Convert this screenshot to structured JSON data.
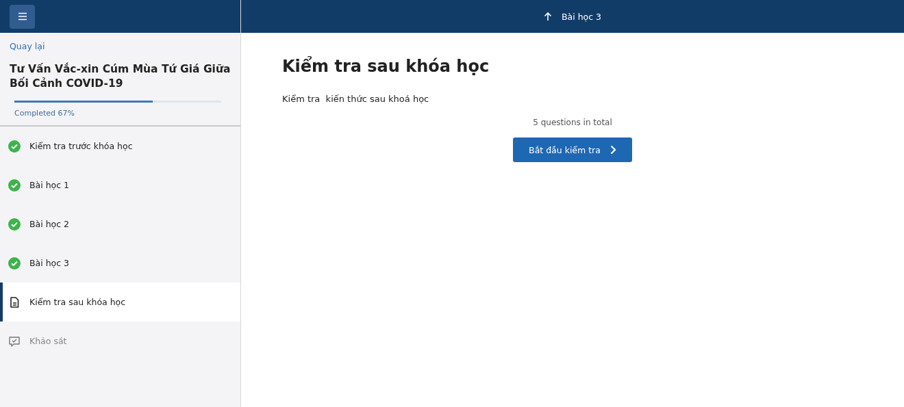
{
  "sidebar": {
    "back_link": "Quay lại",
    "course_title": "Tư Vấn Vắc-xin Cúm Mùa Tứ Giá Giữa Bối Cảnh COVID-19",
    "progress": {
      "level": 0.67,
      "label": "Completed 67%"
    },
    "items": [
      {
        "kind": "done",
        "label": "Kiểm tra trước khóa học",
        "selected": false
      },
      {
        "kind": "done",
        "label": "Bài học 1",
        "selected": false
      },
      {
        "kind": "done",
        "label": "Bài học 2",
        "selected": false
      },
      {
        "kind": "done",
        "label": "Bài học 3",
        "selected": false
      },
      {
        "kind": "quiz",
        "label": "Kiểm tra sau khóa học",
        "selected": true
      },
      {
        "kind": "survey",
        "label": "Khảo sát",
        "selected": false
      }
    ]
  },
  "topbar": {
    "previous_lesson": "Bài học 3"
  },
  "content": {
    "title": "Kiểm tra sau khóa học",
    "description": "Kiểm tra  kiến thức sau khoá học",
    "question_count": "5 questions in total",
    "start_button": "Bắt đầu kiểm tra"
  }
}
